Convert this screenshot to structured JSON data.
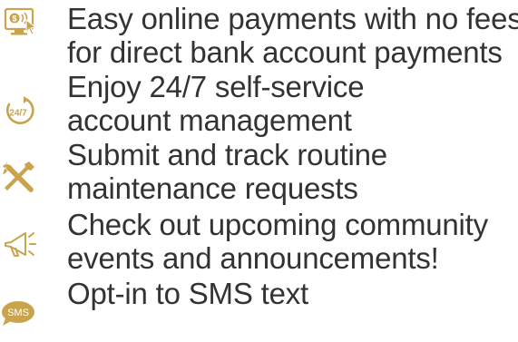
{
  "accent_color": "#c9a44c",
  "text_color": "#333333",
  "features": [
    {
      "icon": "online-payment-icon",
      "lines": [
        "Easy online payments with no fees",
        "for direct bank account payments"
      ]
    },
    {
      "icon": "24-7-clock-icon",
      "icon_label": "24/7",
      "lines": [
        "Enjoy 24/7 self-service",
        "account management"
      ]
    },
    {
      "icon": "wrench-screwdriver-icon",
      "lines": [
        "Submit and track routine",
        "maintenance requests"
      ]
    },
    {
      "icon": "megaphone-icon",
      "lines": [
        "Check out upcoming community",
        "events and announcements!"
      ]
    },
    {
      "icon": "sms-bubble-icon",
      "icon_label": "SMS",
      "lines": [
        "Opt-in to SMS text"
      ]
    }
  ]
}
